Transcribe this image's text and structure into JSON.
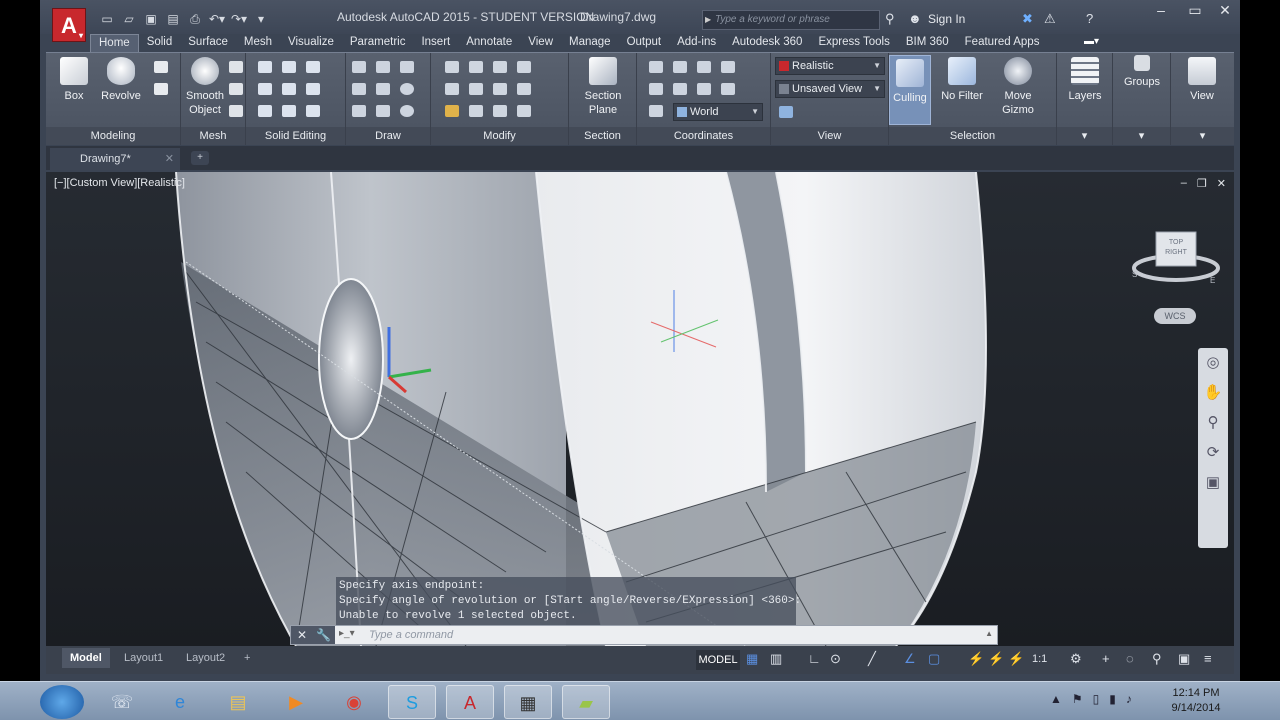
{
  "window": {
    "title": "Autodesk AutoCAD 2015 - STUDENT VERSION",
    "file_name": "Drawing7.dwg",
    "search_placeholder": "Type a keyword or phrase",
    "sign_in": "Sign In"
  },
  "ribbon_tabs": [
    "Home",
    "Solid",
    "Surface",
    "Mesh",
    "Visualize",
    "Parametric",
    "Insert",
    "Annotate",
    "View",
    "Manage",
    "Output",
    "Add-ins",
    "Autodesk 360",
    "Express Tools",
    "BIM 360",
    "Featured Apps"
  ],
  "panels": {
    "modeling": "Modeling",
    "mesh": "Mesh",
    "solid_editing": "Solid Editing",
    "draw": "Draw",
    "modify": "Modify",
    "section": "Section",
    "coordinates": "Coordinates",
    "view": "View",
    "selection": "Selection"
  },
  "buttons": {
    "box": "Box",
    "revolve": "Revolve",
    "smooth_object": "Smooth\nObject",
    "section_plane": "Section\nPlane",
    "culling": "Culling",
    "no_filter": "No Filter",
    "move_gizmo": "Move\nGizmo",
    "layers": "Layers",
    "groups": "Groups",
    "view": "View"
  },
  "combos": {
    "visual_style": "Realistic",
    "named_view": "Unsaved View",
    "ucs": "World"
  },
  "file_tab": "Drawing7*",
  "viewport": {
    "label": "[−][Custom View][Realistic]",
    "wcs": "WCS",
    "viewcube_face": "RIGHT",
    "viewcube_top": "TOP",
    "compass_s": "S",
    "compass_e": "E"
  },
  "command": {
    "history": [
      "Specify axis endpoint:",
      "Specify angle of revolution or [STart angle/Reverse/EXpression] <360>:",
      "Unable to revolve 1 selected object."
    ],
    "placeholder": "Type a command"
  },
  "status": {
    "layout_tabs": [
      "Model",
      "Layout1",
      "Layout2"
    ],
    "model_button": "MODEL",
    "scale": "1:1"
  },
  "taskbar": {
    "time": "12:14 PM",
    "date": "9/14/2014"
  }
}
